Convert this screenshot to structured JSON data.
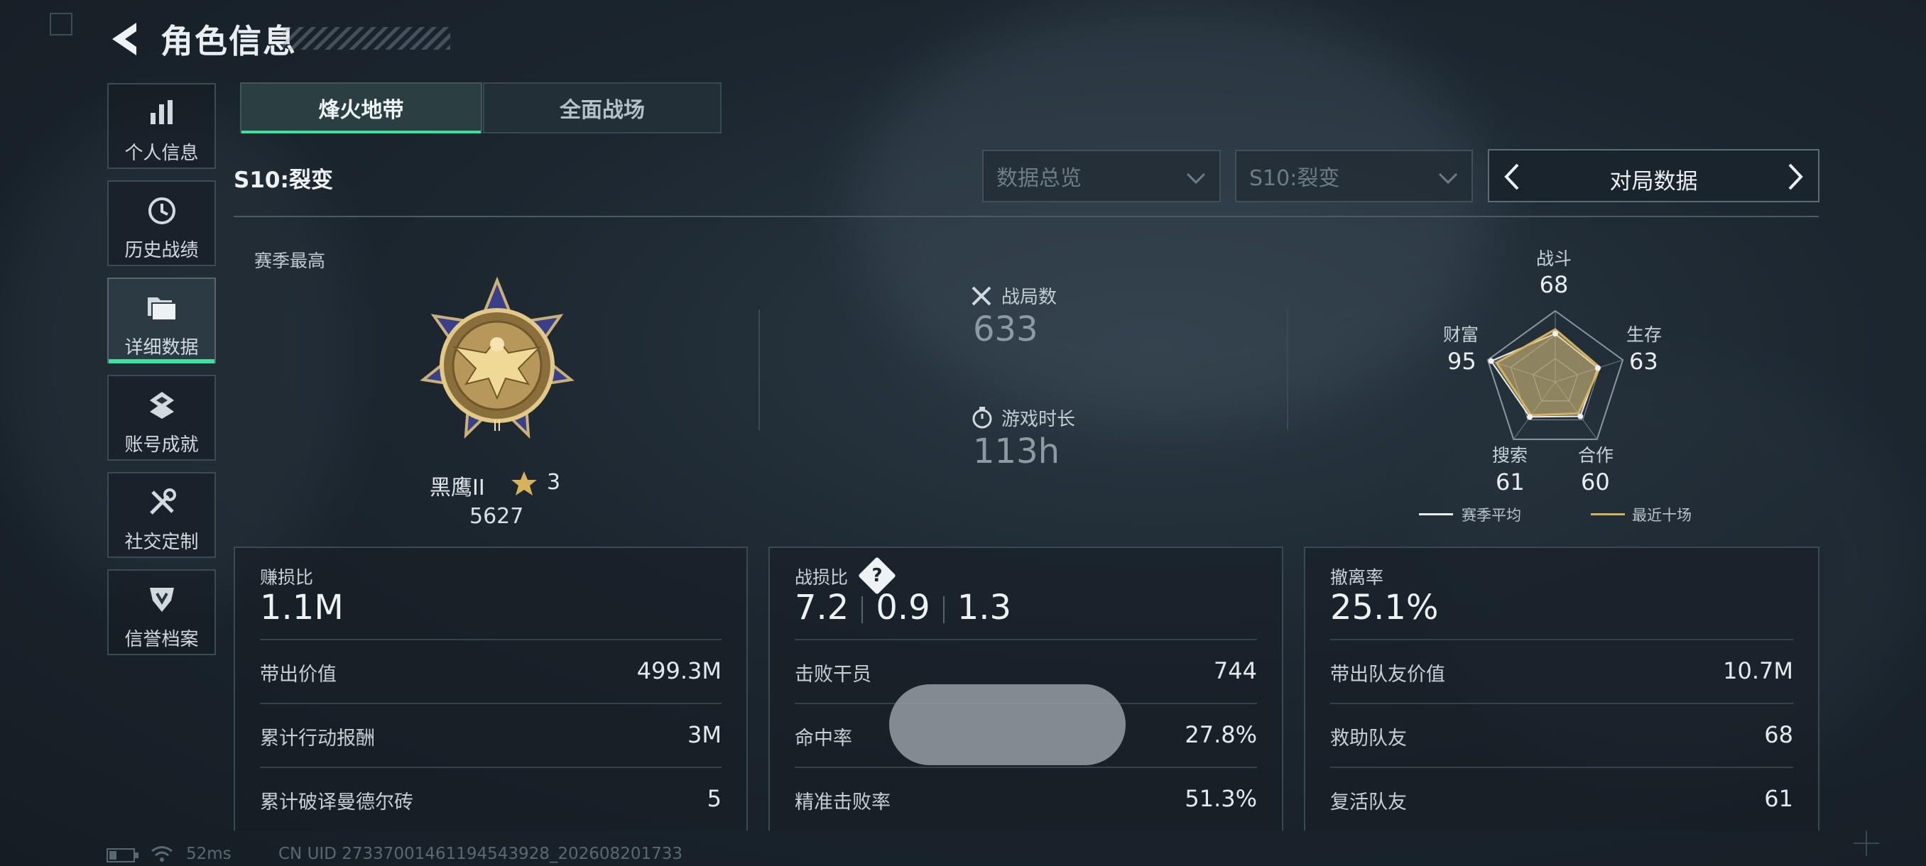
{
  "header": {
    "title": "角色信息"
  },
  "sidebar": {
    "items": [
      {
        "label": "个人信息",
        "icon": "bar-chart-icon"
      },
      {
        "label": "历史战绩",
        "icon": "history-icon"
      },
      {
        "label": "详细数据",
        "icon": "folder-icon",
        "active": true
      },
      {
        "label": "账号成就",
        "icon": "achievement-icon"
      },
      {
        "label": "社交定制",
        "icon": "tools-icon"
      },
      {
        "label": "信誉档案",
        "icon": "credit-shield-icon"
      }
    ]
  },
  "tabs": [
    {
      "label": "烽火地带",
      "active": true
    },
    {
      "label": "全面战场",
      "active": false
    }
  ],
  "season_label": "S10:裂变",
  "filters": {
    "data_scope": "数据总览",
    "season": "S10:裂变",
    "pager_label": "对局数据"
  },
  "rank": {
    "heading": "赛季最高",
    "name": "黑鹰II",
    "stars": "3",
    "score": "5627"
  },
  "stats": {
    "matches_label": "战局数",
    "matches_value": "633",
    "playtime_label": "游戏时长",
    "playtime_value": "113h"
  },
  "radar": {
    "axes": [
      {
        "label": "战斗",
        "value": "68"
      },
      {
        "label": "生存",
        "value": "63"
      },
      {
        "label": "合作",
        "value": "60"
      },
      {
        "label": "搜索",
        "value": "61"
      },
      {
        "label": "财富",
        "value": "95"
      }
    ],
    "season_avg": [
      0.68,
      0.63,
      0.6,
      0.61,
      0.95
    ],
    "recent_ten": [
      0.74,
      0.66,
      0.55,
      0.58,
      0.87
    ],
    "legend": {
      "season_avg": "赛季平均",
      "recent_ten": "最近十场"
    },
    "colors": {
      "season_avg": "#e8eef2",
      "recent_ten": "#d6b35a"
    }
  },
  "cards": {
    "profit": {
      "title": "赚损比",
      "value": "1.1M",
      "rows": [
        {
          "label": "带出价值",
          "value": "499.3M"
        },
        {
          "label": "累计行动报酬",
          "value": "3M"
        },
        {
          "label": "累计破译曼德尔砖",
          "value": "5"
        }
      ]
    },
    "kd": {
      "title": "战损比",
      "help": "?",
      "values": [
        "7.2",
        "0.9",
        "1.3"
      ],
      "rows": [
        {
          "label": "击败干员",
          "value": "744"
        },
        {
          "label": "命中率",
          "value": "27.8%"
        },
        {
          "label": "精准击败率",
          "value": "51.3%"
        }
      ]
    },
    "extract": {
      "title": "撤离率",
      "value": "25.1%",
      "rows": [
        {
          "label": "带出队友价值",
          "value": "10.7M"
        },
        {
          "label": "救助队友",
          "value": "68"
        },
        {
          "label": "复活队友",
          "value": "61"
        }
      ]
    }
  },
  "footer": {
    "ping": "52ms",
    "uid": "CN UID 27337001461194543928_202608201733"
  },
  "colors": {
    "accent": "#3ee0a0",
    "gold": "#d6b35a"
  }
}
